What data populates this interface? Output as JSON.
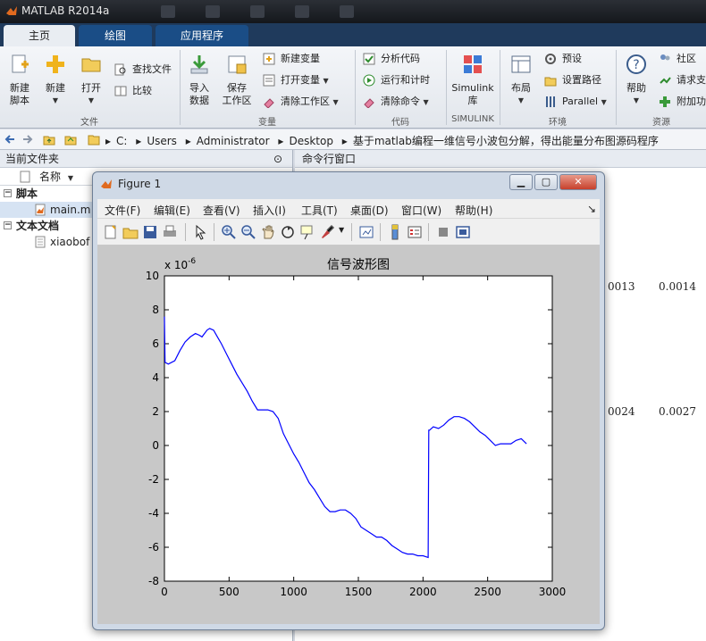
{
  "app": {
    "title": "MATLAB R2014a"
  },
  "tabs": [
    {
      "label": "主页"
    },
    {
      "label": "绘图"
    },
    {
      "label": "应用程序"
    }
  ],
  "ribbon": {
    "file": {
      "new_script": "新建\n脚本",
      "new_script_l1": "新建",
      "new_script_l2": "脚本",
      "new": "新建",
      "open": "打开",
      "find_files": "查找文件",
      "compare": "比较",
      "group_label": "文件"
    },
    "variable": {
      "import_l1": "导入",
      "import_l2": "数据",
      "save_l1": "保存",
      "save_l2": "工作区",
      "new_variable": "新建变量",
      "open_variable": "打开变量",
      "clear_workspace": "清除工作区",
      "group_label": "变量"
    },
    "code": {
      "analyze": "分析代码",
      "run_time": "运行和计时",
      "clear_commands": "清除命令",
      "group_label": "代码"
    },
    "simulink": {
      "l1": "Simulink",
      "l2": "库",
      "group_label": "SIMULINK"
    },
    "environment": {
      "layout": "布局",
      "preferences": "预设",
      "set_path": "设置路径",
      "parallel": "Parallel",
      "group_label": "环境"
    },
    "resources": {
      "help": "帮助",
      "community": "社区",
      "request_support": "请求支",
      "addons": "附加功",
      "group_label": "资源"
    }
  },
  "address": {
    "path": [
      "C:",
      "Users",
      "Administrator",
      "Desktop",
      "基于matlab编程一维信号小波包分解，得出能量分布图源码程序"
    ]
  },
  "left_panel": {
    "title": "当前文件夹",
    "column_name": "名称",
    "groups": [
      {
        "label": "脚本",
        "items": [
          "main.m"
        ]
      },
      {
        "label": "文本文档",
        "items": [
          "xiaobof"
        ]
      }
    ]
  },
  "right_panel": {
    "title": "命令行窗口",
    "values_row1": [
      "0013",
      "0.0014"
    ],
    "values_row2": [
      "0024",
      "0.0027"
    ]
  },
  "figure": {
    "title": "Figure 1",
    "menus": [
      "文件(F)",
      "编辑(E)",
      "查看(V)",
      "插入(I)",
      "工具(T)",
      "桌面(D)",
      "窗口(W)",
      "帮助(H)"
    ],
    "menu_arrow": "↘"
  },
  "chart_data": {
    "type": "line",
    "title": "信号波形图",
    "xlabel": "",
    "ylabel": "",
    "exponent_label": "x 10",
    "exponent": "-6",
    "xlim": [
      0,
      3000
    ],
    "ylim": [
      -8,
      10
    ],
    "xticks": [
      0,
      500,
      1000,
      1500,
      2000,
      2500,
      3000
    ],
    "yticks": [
      -8,
      -6,
      -4,
      -2,
      0,
      2,
      4,
      6,
      8,
      10
    ],
    "line_color": "#0000ff",
    "series": [
      {
        "x": [
          0,
          5,
          30,
          80,
          120,
          160,
          200,
          240,
          270,
          290,
          310,
          330,
          350,
          380,
          410,
          440,
          480,
          520,
          560,
          600,
          640,
          680,
          720,
          760,
          800,
          840,
          880,
          920,
          960,
          1000,
          1040,
          1080,
          1120,
          1160,
          1200,
          1240,
          1280,
          1320,
          1360,
          1400,
          1440,
          1480,
          1520,
          1560,
          1600,
          1640,
          1680,
          1720,
          1760,
          1800,
          1840,
          1880,
          1920,
          1960,
          2000,
          2040,
          2045,
          2050,
          2080,
          2120,
          2160,
          2200,
          2240,
          2280,
          2320,
          2360,
          2400,
          2440,
          2480,
          2520,
          2560,
          2600,
          2640,
          2680,
          2720,
          2760,
          2800
        ],
        "y": [
          7.6,
          4.9,
          4.8,
          5.0,
          5.6,
          6.1,
          6.4,
          6.6,
          6.5,
          6.4,
          6.6,
          6.8,
          6.9,
          6.8,
          6.4,
          6.0,
          5.4,
          4.8,
          4.2,
          3.7,
          3.2,
          2.6,
          2.1,
          2.1,
          2.1,
          2.0,
          1.6,
          0.7,
          0.1,
          -0.5,
          -1.0,
          -1.6,
          -2.2,
          -2.6,
          -3.1,
          -3.6,
          -3.9,
          -3.9,
          -3.8,
          -3.8,
          -4.0,
          -4.3,
          -4.8,
          -5.0,
          -5.2,
          -5.4,
          -5.4,
          -5.6,
          -5.9,
          -6.1,
          -6.3,
          -6.4,
          -6.4,
          -6.5,
          -6.5,
          -6.6,
          0.9,
          0.9,
          1.1,
          1.0,
          1.2,
          1.5,
          1.7,
          1.7,
          1.6,
          1.4,
          1.1,
          0.8,
          0.6,
          0.3,
          0.0,
          0.1,
          0.1,
          0.1,
          0.3,
          0.4,
          0.1
        ]
      }
    ]
  }
}
